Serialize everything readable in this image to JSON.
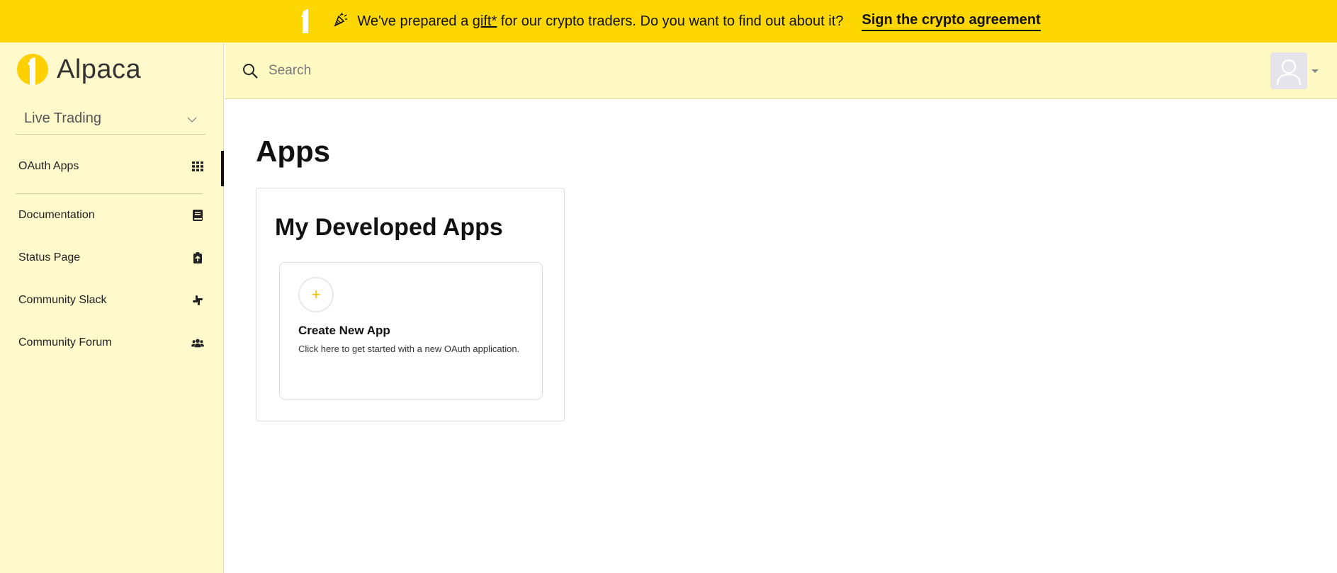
{
  "banner": {
    "text_before": "We've prepared a",
    "gift_label": "gift*",
    "text_after": "for our crypto traders. Do you want to find out about it?",
    "cta_label": "Sign the crypto agreement"
  },
  "brand": {
    "name": "Alpaca"
  },
  "env_select": {
    "value": "Live Trading"
  },
  "sidebar": {
    "items": [
      {
        "label": "OAuth Apps",
        "icon": "grid-icon",
        "active": true
      },
      {
        "label": "Documentation",
        "icon": "book-icon"
      },
      {
        "label": "Status Page",
        "icon": "clipboard-icon"
      },
      {
        "label": "Community Slack",
        "icon": "slack-icon"
      },
      {
        "label": "Community Forum",
        "icon": "users-icon"
      }
    ]
  },
  "search": {
    "placeholder": "Search",
    "value": ""
  },
  "main": {
    "title": "Apps",
    "panel_title": "My Developed Apps",
    "card": {
      "plus": "+",
      "title": "Create New App",
      "description": "Click here to get started with a new OAuth application."
    }
  },
  "colors": {
    "accent": "#FFD700",
    "sidebar_bg": "#FFF9CC",
    "topbar_bg": "#FFF9C4"
  }
}
